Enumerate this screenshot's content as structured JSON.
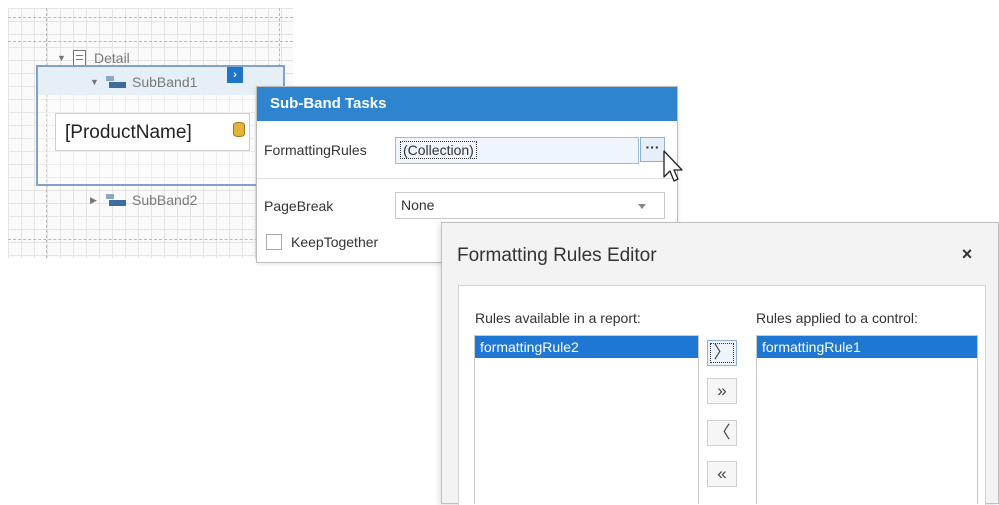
{
  "designer": {
    "detail_label": "Detail",
    "subband1_label": "SubBand1",
    "subband2_label": "SubBand2",
    "field_text": "[ProductName]",
    "smart_tag_glyph": "›"
  },
  "tasks_panel": {
    "title": "Sub-Band Tasks",
    "formatting_rules_label": "FormattingRules",
    "formatting_rules_value": "(Collection)",
    "ellipsis": "···",
    "page_break_label": "PageBreak",
    "page_break_value": "None",
    "keep_together_label": "KeepTogether",
    "keep_together_checked": false
  },
  "editor": {
    "title": "Formatting Rules Editor",
    "close_glyph": "×",
    "available_caption": "Rules available in a report:",
    "applied_caption": "Rules applied to a control:",
    "available_rules": [
      "formattingRule2"
    ],
    "applied_rules": [
      "formattingRule1"
    ],
    "buttons": {
      "add": "〉",
      "add_all": "»",
      "remove": "〈",
      "remove_all": "«"
    }
  },
  "colors": {
    "accent": "#2f84d0",
    "selection": "#1e78d3",
    "smart_tag": "#1f74cc"
  }
}
